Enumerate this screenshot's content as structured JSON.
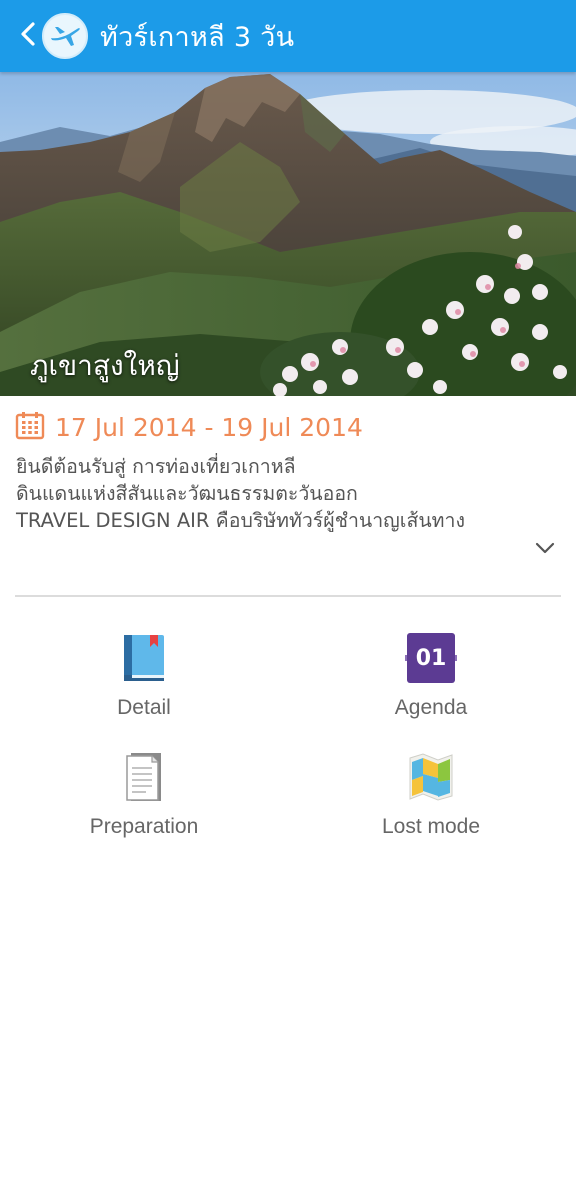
{
  "topbar": {
    "title": "ทัวร์เกาหลี 3 วัน",
    "back_icon": "chevron-left-icon",
    "logo_icon": "airplane-icon",
    "color": "#1c9be8"
  },
  "hero": {
    "caption": "ภูเขาสูงใหญ่"
  },
  "trip": {
    "date_range": "17 Jul 2014 - 19 Jul 2014",
    "date_icon": "calendar-icon",
    "date_color": "#ef8a57",
    "description_lines": [
      "ยินดีต้อนรับสู่ การท่องเที่ยวเกาหลี",
      "ดินแดนแห่งสีสันและวัฒนธรรมตะวันออก",
      "TRAVEL DESIGN AIR  คือบริษัททัวร์ผู้ชำนาญเส้นทาง"
    ],
    "expand_icon": "chevron-down-icon"
  },
  "menu": {
    "items": [
      {
        "label": "Detail",
        "icon": "book-icon"
      },
      {
        "label": "Agenda",
        "icon": "calendar-day-icon",
        "badge": "01"
      },
      {
        "label": "Preparation",
        "icon": "document-icon"
      },
      {
        "label": "Lost mode",
        "icon": "map-icon"
      }
    ]
  }
}
